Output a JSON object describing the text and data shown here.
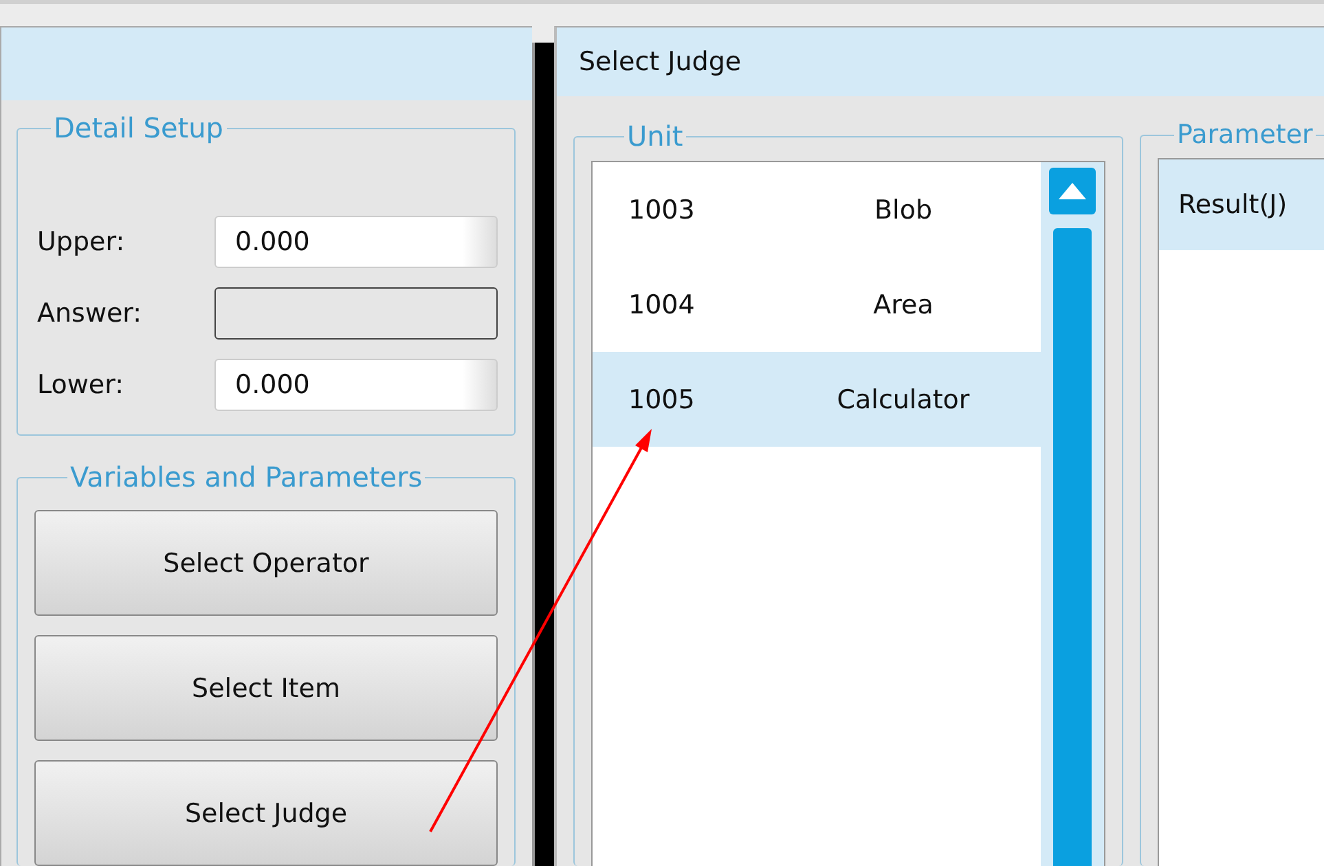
{
  "left_panel": {
    "detail_setup": {
      "title": "Detail Setup",
      "fields": [
        {
          "label": "Upper:",
          "value": "0.000",
          "disabled": false
        },
        {
          "label": "Answer:",
          "disabled": true
        },
        {
          "label": "Lower:",
          "value": "0.000",
          "disabled": false
        }
      ]
    },
    "variables": {
      "title": "Variables and Parameters",
      "buttons": [
        "Select Operator",
        "Select Item",
        "Select Judge"
      ]
    }
  },
  "dialog": {
    "title": "Select Judge",
    "unit": {
      "title": "Unit",
      "rows": [
        {
          "id": "1003",
          "name": "Blob",
          "selected": false
        },
        {
          "id": "1004",
          "name": "Area",
          "selected": false
        },
        {
          "id": "1005",
          "name": "Calculator",
          "selected": true
        }
      ]
    },
    "parameter": {
      "title": "Parameter",
      "rows": [
        {
          "label": "Result(J)",
          "selected": true
        }
      ]
    }
  }
}
